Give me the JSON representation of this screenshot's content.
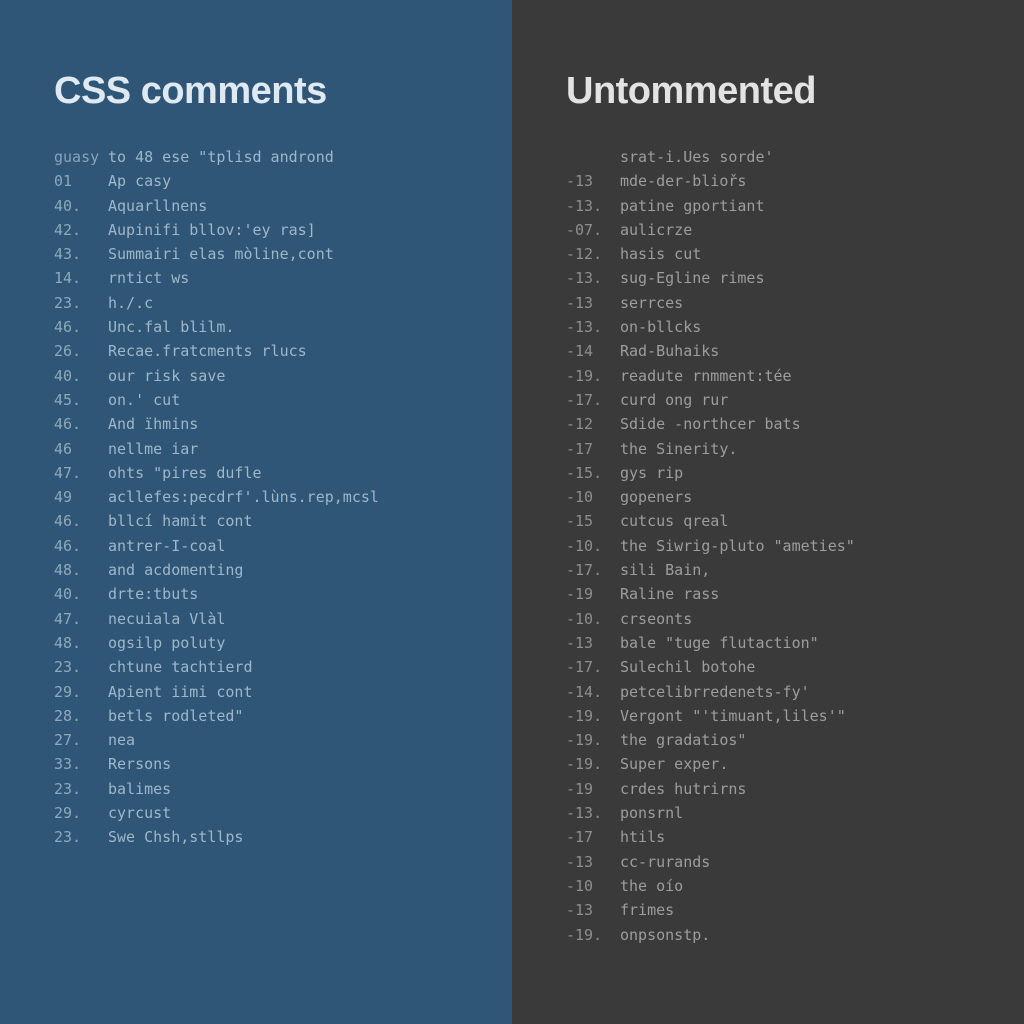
{
  "left": {
    "title_strong": "CSS",
    "title_rest": " comments",
    "lines": [
      {
        "ln": "guasy",
        "txt": "to 48 ese \"tplisd andrond"
      },
      {
        "ln": "01",
        "txt": "Ap casy"
      },
      {
        "ln": "40.",
        "txt": "Aquarllnens"
      },
      {
        "ln": "42.",
        "txt": "Aupinifi bllov:'ey ras]"
      },
      {
        "ln": "43.",
        "txt": "Summairi elas mòline,cont"
      },
      {
        "ln": "14.",
        "txt": "rntict ws"
      },
      {
        "ln": "23.",
        "txt": "h./.c"
      },
      {
        "ln": "46.",
        "txt": "Unc.fal blilm."
      },
      {
        "ln": "26.",
        "txt": "Recae.fratcments rlucs"
      },
      {
        "ln": "40.",
        "txt": "our risk save"
      },
      {
        "ln": "45.",
        "txt": "on.' cut"
      },
      {
        "ln": "46.",
        "txt": "And ïhmins"
      },
      {
        "ln": "46",
        "txt": "nellme iar"
      },
      {
        "ln": "47.",
        "txt": "ohts \"pires dufle"
      },
      {
        "ln": "49",
        "txt": "acllefes:pecdrf'.lùns.rep,mcsl"
      },
      {
        "ln": "46.",
        "txt": "bllcí hamit cont"
      },
      {
        "ln": "46.",
        "txt": "antrer-I-coal"
      },
      {
        "ln": "48.",
        "txt": "and acdomenting"
      },
      {
        "ln": "40.",
        "txt": "drte:tbuts"
      },
      {
        "ln": "47.",
        "txt": "necuiala Vlàl"
      },
      {
        "ln": "48.",
        "txt": "ogsilp poluty"
      },
      {
        "ln": "23.",
        "txt": "chtune tachtierd"
      },
      {
        "ln": "29.",
        "txt": "Apient iimi cont"
      },
      {
        "ln": "28.",
        "txt": "betls rodleted\""
      },
      {
        "ln": "27.",
        "txt": "nea"
      },
      {
        "ln": "33.",
        "txt": "Rersons"
      },
      {
        "ln": "23.",
        "txt": "balimes"
      },
      {
        "ln": "29.",
        "txt": "cyrcust"
      },
      {
        "ln": "23.",
        "txt": "Swe Chsh,stllps"
      }
    ]
  },
  "right": {
    "title": "Untommented",
    "lines": [
      {
        "ln": "",
        "txt": "srat-i.Ues sorde'"
      },
      {
        "ln": "-13",
        "txt": "mde-der-bliořs"
      },
      {
        "ln": "-13.",
        "txt": "patine gportiant"
      },
      {
        "ln": "-07.",
        "txt": "aulicrze"
      },
      {
        "ln": "-12.",
        "txt": "hasis cut"
      },
      {
        "ln": "-13.",
        "txt": "sug-Egline rimes"
      },
      {
        "ln": "-13",
        "txt": "serrces"
      },
      {
        "ln": "-13.",
        "txt": "on-bllcks"
      },
      {
        "ln": "-14",
        "txt": "Rad-Buhaiks"
      },
      {
        "ln": "-19.",
        "txt": "readute rnmment:tée"
      },
      {
        "ln": "-17.",
        "txt": "curd ong rur"
      },
      {
        "ln": "-12",
        "txt": "Sdide -northcer bats"
      },
      {
        "ln": "-17",
        "txt": "the Sinerity."
      },
      {
        "ln": "-15.",
        "txt": "gys rip"
      },
      {
        "ln": "-10",
        "txt": "gopeners"
      },
      {
        "ln": "-15",
        "txt": "cutcus qreal"
      },
      {
        "ln": "-10.",
        "txt": "the Siwrig-pluto \"ameties\""
      },
      {
        "ln": "-17.",
        "txt": "sili Bain,"
      },
      {
        "ln": "-19",
        "txt": "Raline rass"
      },
      {
        "ln": "-10.",
        "txt": "crseonts"
      },
      {
        "ln": "-13",
        "txt": "bale \"tuge flutaction\""
      },
      {
        "ln": "-17.",
        "txt": "Sulechil botohe"
      },
      {
        "ln": "-14.",
        "txt": "petcelibrredenets-fy'"
      },
      {
        "ln": "-19.",
        "txt": "Vergont \"'timuant,liles'\""
      },
      {
        "ln": "-19.",
        "txt": "the gradatios\""
      },
      {
        "ln": "-19.",
        "txt": "Super exper."
      },
      {
        "ln": "-19",
        "txt": "crdes hutrirns"
      },
      {
        "ln": "-13.",
        "txt": "ponsrnl"
      },
      {
        "ln": "-17",
        "txt": "htils"
      },
      {
        "ln": "-13",
        "txt": "cc-rurands"
      },
      {
        "ln": "-10",
        "txt": "the oío"
      },
      {
        "ln": "-13",
        "txt": "frimes"
      },
      {
        "ln": "-19.",
        "txt": "onpsonstp."
      }
    ]
  }
}
